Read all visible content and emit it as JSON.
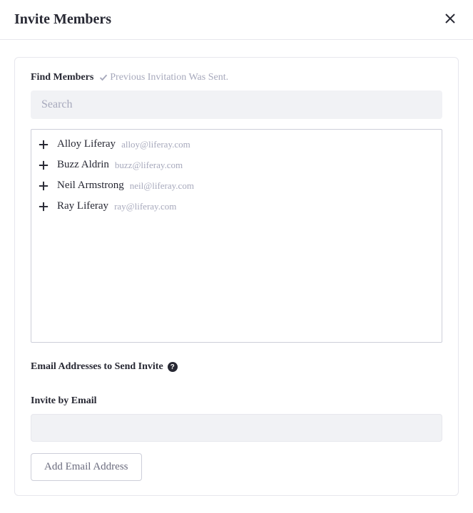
{
  "modal": {
    "title": "Invite Members"
  },
  "findMembers": {
    "label": "Find Members",
    "statusMessage": "Previous Invitation Was Sent.",
    "searchPlaceholder": "Search"
  },
  "members": [
    {
      "name": "Alloy Liferay",
      "email": "alloy@liferay.com"
    },
    {
      "name": "Buzz Aldrin",
      "email": "buzz@liferay.com"
    },
    {
      "name": "Neil Armstrong",
      "email": "neil@liferay.com"
    },
    {
      "name": "Ray Liferay",
      "email": "ray@liferay.com"
    }
  ],
  "emailSection": {
    "label": "Email Addresses to Send Invite",
    "helpSymbol": "?",
    "subLabel": "Invite by Email",
    "addButton": "Add Email Address"
  }
}
